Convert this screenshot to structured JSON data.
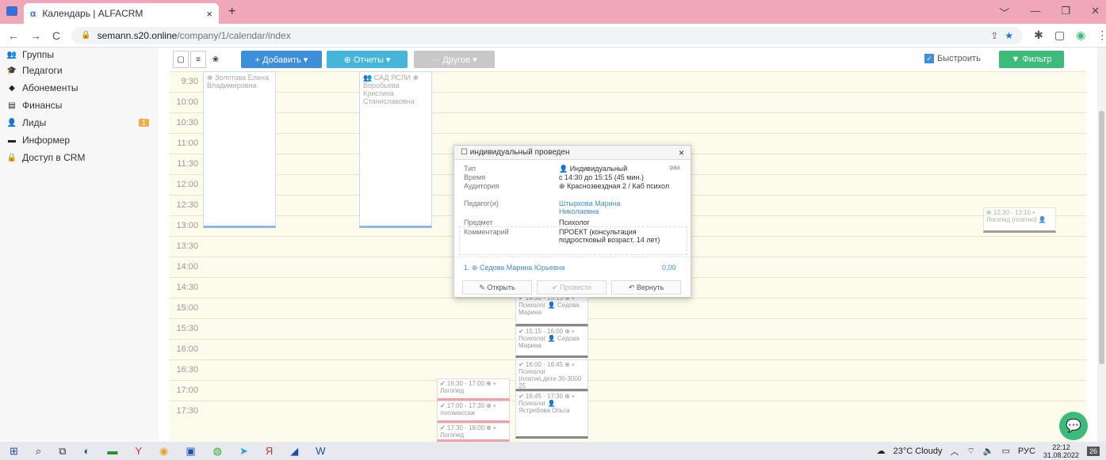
{
  "browser": {
    "tab_title": "Календарь | ALFACRM",
    "tab_close": "×",
    "new_tab": "+",
    "url_host": "semann.s20.online",
    "url_path": "/company/1/calendar/index"
  },
  "sidebar": {
    "items": [
      {
        "label": "Группы",
        "icon": "users-icon"
      },
      {
        "label": "Педагоги",
        "icon": "graduation-cap-icon"
      },
      {
        "label": "Абонементы",
        "icon": "tag-icon"
      },
      {
        "label": "Финансы",
        "icon": "money-icon"
      },
      {
        "label": "Лиды",
        "icon": "user-plus-icon",
        "badge": "1"
      },
      {
        "label": "Информер",
        "icon": "newspaper-icon"
      },
      {
        "label": "Доступ в CRM",
        "icon": "lock-icon"
      }
    ]
  },
  "toolbar": {
    "add": "+ Добавить ▾",
    "reports": "⊕ Отчеты ▾",
    "other": "··· Другое ▾",
    "fast": "Быстроить",
    "filter": "▼ Фильтр",
    "colors": {
      "add": "#3d8fd9",
      "reports": "#45b5d9",
      "other": "#c8c8c8",
      "filter": "#3cbb7a"
    }
  },
  "calendar": {
    "times": [
      "9:30",
      "10:00",
      "10:30",
      "11:00",
      "11:30",
      "12:00",
      "12:30",
      "13:00",
      "13:30",
      "14:00",
      "14:30",
      "15:00",
      "15:30",
      "16:00",
      "16:30",
      "17:00",
      "17:30"
    ],
    "col1_text": "❀ Золотова Елена Владимировна",
    "col2_text": "👥 САД ЯСЛИ ❀ Воробьева Кристина Станиславовна",
    "events": [
      {
        "text": "✔ 14:30 - 15:15 ⊕ ▪ Психолог 👤 Седова Марина"
      },
      {
        "text": "✔ 15:15 - 16:00 ⊕ ▪ Психолог 👤 Седова Марина"
      },
      {
        "text": "✔ 16:00 - 16:45 ⊕ ▪ Психолог (платно,дети 30-3000 25"
      },
      {
        "text": "✔ 16:45 - 17:30 ⊕ ▪ Психолог 👤 Ястребова Ольга"
      },
      {
        "text": "✔ 16:30 - 17:00 ⊕ ▪ Логопед"
      },
      {
        "text": "✔ 17:00 - 17:30 ⊕ ▪ логомассаж"
      },
      {
        "text": "✔ 17:30 - 18:00 ⊕ ▪ Логопед"
      },
      {
        "text": "⊕ 12:30 - 13:10 ▪ Логопед (платно) 👤"
      }
    ]
  },
  "popup": {
    "title": "☐ индивидуальный проведен",
    "close": "×",
    "type_label": "Тип",
    "type_value": "👤 Индивидуальный",
    "type_extra": "раз",
    "time_label": "Время",
    "time_value": "с 14:30 до 15:15 (45 мин.)",
    "room_label": "Аудитория",
    "room_value": "⊕ Краснозвездная 2 / Каб психол",
    "teacher_label": "Педагог(и)",
    "teacher_value": "Штыркова Марина Николаевна",
    "subject_label": "Предмет",
    "subject_value": "Психолог",
    "comment_label": "Комментарий",
    "comment_value": "ПРОЕКТ (консультация подростковый возраст, 14 лет)",
    "client": "1. ⊕ Седова Марина Юрьевна",
    "client_amount": "0,00",
    "btn_open": "✎ Открыть",
    "btn_conduct": "✔ Провести",
    "btn_return": "↶ Вернуть"
  },
  "taskbar": {
    "weather": "23°C Cloudy",
    "lang": "РУС",
    "time": "22:12",
    "date": "31.08.2022",
    "notif": "26"
  }
}
